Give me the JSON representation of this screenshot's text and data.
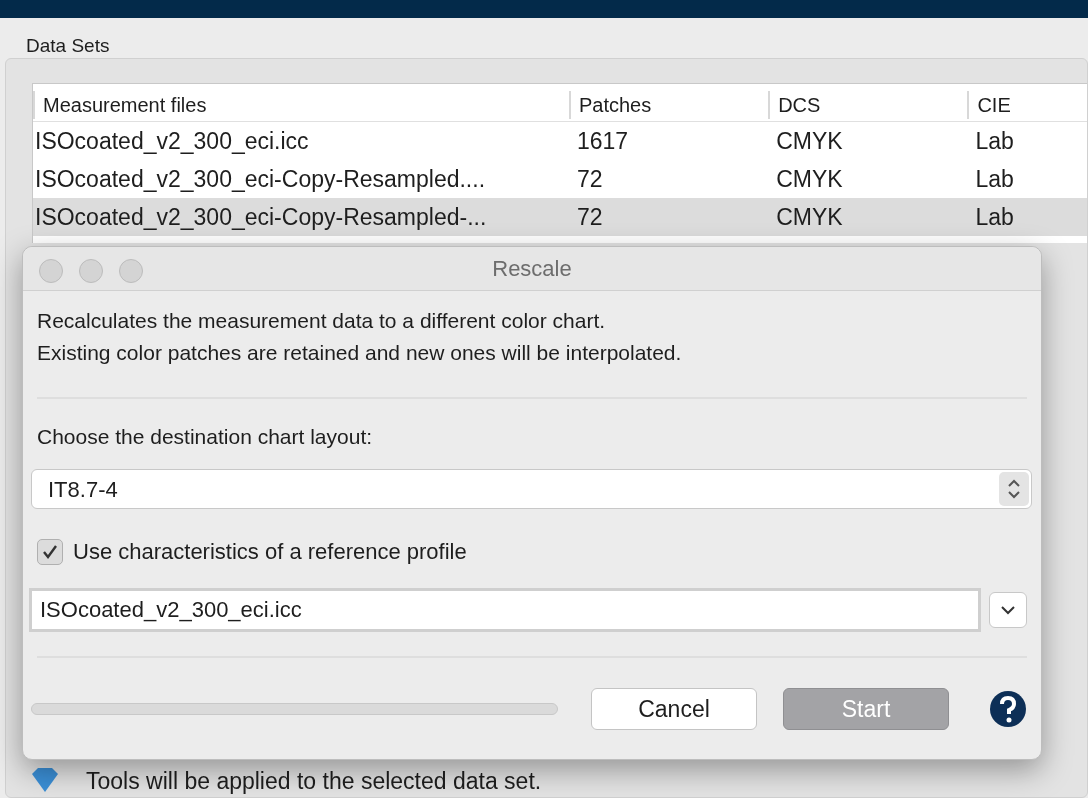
{
  "panel": {
    "title": "Data Sets"
  },
  "table": {
    "columns": [
      "Measurement files",
      "Patches",
      "DCS",
      "CIE"
    ],
    "rows": [
      {
        "cells": [
          "ISOcoated_v2_300_eci.icc",
          "1617",
          "CMYK",
          "Lab"
        ],
        "selected": false
      },
      {
        "cells": [
          "ISOcoated_v2_300_eci-Copy-Resampled....",
          "72",
          "CMYK",
          "Lab"
        ],
        "selected": false
      },
      {
        "cells": [
          "ISOcoated_v2_300_eci-Copy-Resampled-...",
          "72",
          "CMYK",
          "Lab"
        ],
        "selected": true
      }
    ]
  },
  "dialog": {
    "title": "Rescale",
    "description": [
      "Recalculates the measurement data to a different color chart.",
      "Existing color patches are retained and new ones will be interpolated."
    ],
    "layout_label": "Choose the destination chart layout:",
    "layout_select": {
      "value": "IT8.7-4"
    },
    "reference_checkbox": {
      "label": "Use characteristics of a reference profile",
      "checked": true
    },
    "reference_field": {
      "value": "ISOcoated_v2_300_eci.icc"
    },
    "progress": {
      "level": 0
    },
    "buttons": [
      {
        "label": "Cancel",
        "kind": "secondary"
      },
      {
        "label": "Start",
        "kind": "primary"
      }
    ]
  },
  "info": {
    "text": "Tools will be applied to the selected data set."
  }
}
